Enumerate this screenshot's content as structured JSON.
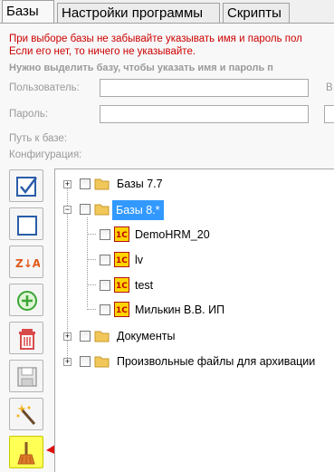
{
  "tabs": [
    {
      "label": "Базы"
    },
    {
      "label": "Настройки программы"
    },
    {
      "label": "Скрипты"
    }
  ],
  "warning": {
    "line1": "При выборе базы не забывайте указывать имя и пароль пол",
    "line2": "Если его нет, то ничего не указывайте."
  },
  "hint": "Нужно выделить базу, чтобы указать имя и пароль п",
  "form": {
    "user_label": "Пользователь:",
    "user_value": "",
    "user_side_label": "В",
    "password_label": "Пароль:",
    "password_value": "",
    "path_label": "Путь к базе:",
    "config_label": "Конфигурация:"
  },
  "toolbar": [
    {
      "icon": "check-all-icon"
    },
    {
      "icon": "uncheck-all-icon"
    },
    {
      "icon": "sort-za-icon",
      "text": "Z↓A"
    },
    {
      "icon": "add-icon"
    },
    {
      "icon": "trash-icon"
    },
    {
      "icon": "save-icon"
    },
    {
      "icon": "magic-wand-icon"
    },
    {
      "icon": "broom-icon",
      "highlighted": true
    }
  ],
  "tree": {
    "groups": [
      {
        "label": "Базы 7.7",
        "expanded": false
      },
      {
        "label": "Базы 8.*",
        "expanded": true,
        "selected": true,
        "children": [
          {
            "label": "DemoHRM_20"
          },
          {
            "label": "lv"
          },
          {
            "label": "test"
          },
          {
            "label": "Милькин В.В. ИП"
          }
        ]
      },
      {
        "label": "Документы",
        "expanded": false
      },
      {
        "label": "Произвольные файлы для архивации",
        "expanded": false
      }
    ],
    "onec_icon_text": "1C"
  },
  "colors": {
    "warning": "#cc0000",
    "selection": "#3399ff",
    "highlight": "#ffff55",
    "arrow": "#e01010",
    "folder": "#f2c75a"
  }
}
